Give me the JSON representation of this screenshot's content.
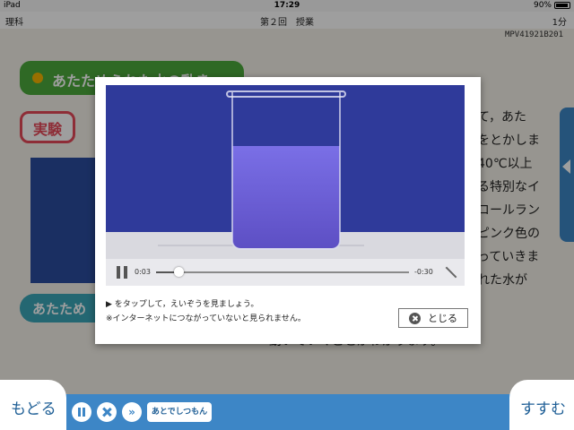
{
  "status_bar": {
    "device": "iPad",
    "time": "17:29",
    "battery": "90%"
  },
  "header": {
    "subject": "理科",
    "title": "第２回　授業",
    "duration": "1分"
  },
  "lesson": {
    "video_id": "MPV41921B201",
    "section_title": "あたためられた水の動き",
    "experiment_badge": "実験",
    "button_label": "あたため",
    "right_text_lines": [
      "て，あた",
      "をとかしま",
      "40℃以上",
      "る特別なイ",
      "コールラン",
      "ピンク色の",
      "っていきま",
      "れた水が"
    ],
    "bottom_text": "動いていくことがわかります。"
  },
  "modal": {
    "video": {
      "current_time": "0:03",
      "remaining_time": "-0:30",
      "progress": 0.09
    },
    "instruction_line1": "▶ をタップして，えいぞうを見ましょう。",
    "instruction_line2": "※インターネットにつながっていないと見られません。",
    "close_label": "とじる"
  },
  "bottom_bar": {
    "back_label": "もどる",
    "next_label": "すすむ",
    "skip_symbol": "»",
    "later_label": "あとでしつもん"
  }
}
